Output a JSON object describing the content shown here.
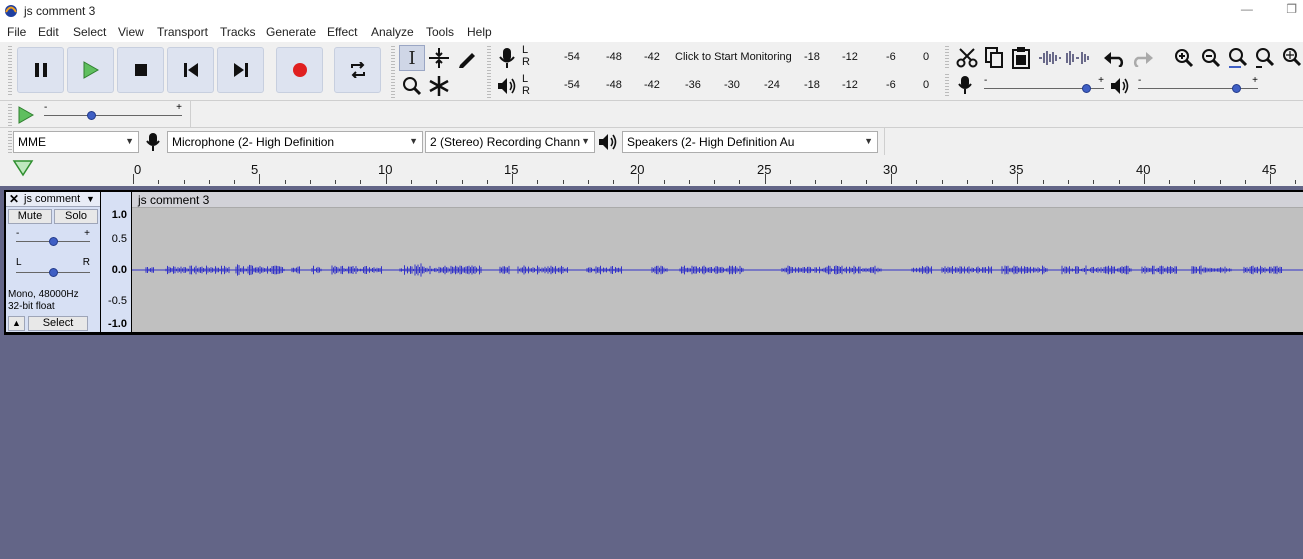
{
  "window": {
    "title": "js comment 3",
    "minimize": "—",
    "restore": "❐"
  },
  "menu": [
    "File",
    "Edit",
    "Select",
    "View",
    "Transport",
    "Tracks",
    "Generate",
    "Effect",
    "Analyze",
    "Tools",
    "Help"
  ],
  "transport": {
    "buttons": [
      "pause",
      "play",
      "stop",
      "skip-to-start",
      "skip-to-end",
      "record",
      "loop"
    ]
  },
  "meters": {
    "record_ticks": [
      "-54",
      "-48",
      "-42",
      "Click to Start Monitoring",
      "-18",
      "-12",
      "-6",
      "0"
    ],
    "playback_ticks": [
      "-54",
      "-48",
      "-42",
      "-36",
      "-30",
      "-24",
      "-18",
      "-12",
      "-6",
      "0"
    ],
    "channel_L": "L",
    "channel_R": "R"
  },
  "mixer": {
    "minus": "-",
    "plus": "+",
    "record_volume_fraction": 0.88,
    "playback_volume_fraction": 0.85
  },
  "play_at_speed": {
    "minus": "-",
    "plus": "+",
    "speed_fraction": 0.33
  },
  "device": {
    "host": "MME",
    "recording_device": "Microphone (2- High Definition",
    "channels": "2 (Stereo) Recording Chann",
    "playback_device": "Speakers (2- High Definition Au"
  },
  "ruler": {
    "labels": [
      "0",
      "5",
      "10",
      "15",
      "20",
      "25",
      "30",
      "35",
      "40",
      "45"
    ]
  },
  "track": {
    "name": "js comment",
    "clip_name": "js comment 3",
    "mute": "Mute",
    "solo": "Solo",
    "gain_minus": "-",
    "gain_plus": "+",
    "pan_left": "L",
    "pan_right": "R",
    "info_line1": "Mono, 48000Hz",
    "info_line2": "32-bit float",
    "select": "Select",
    "gain_fraction": 0.5,
    "pan_fraction": 0.5,
    "scale": [
      "1.0",
      "0.5",
      "0.0",
      "-0.5",
      "-1.0"
    ]
  },
  "colors": {
    "waveform": "#3232c8",
    "background": "#636587",
    "track_panel": "#d7e0f4"
  }
}
